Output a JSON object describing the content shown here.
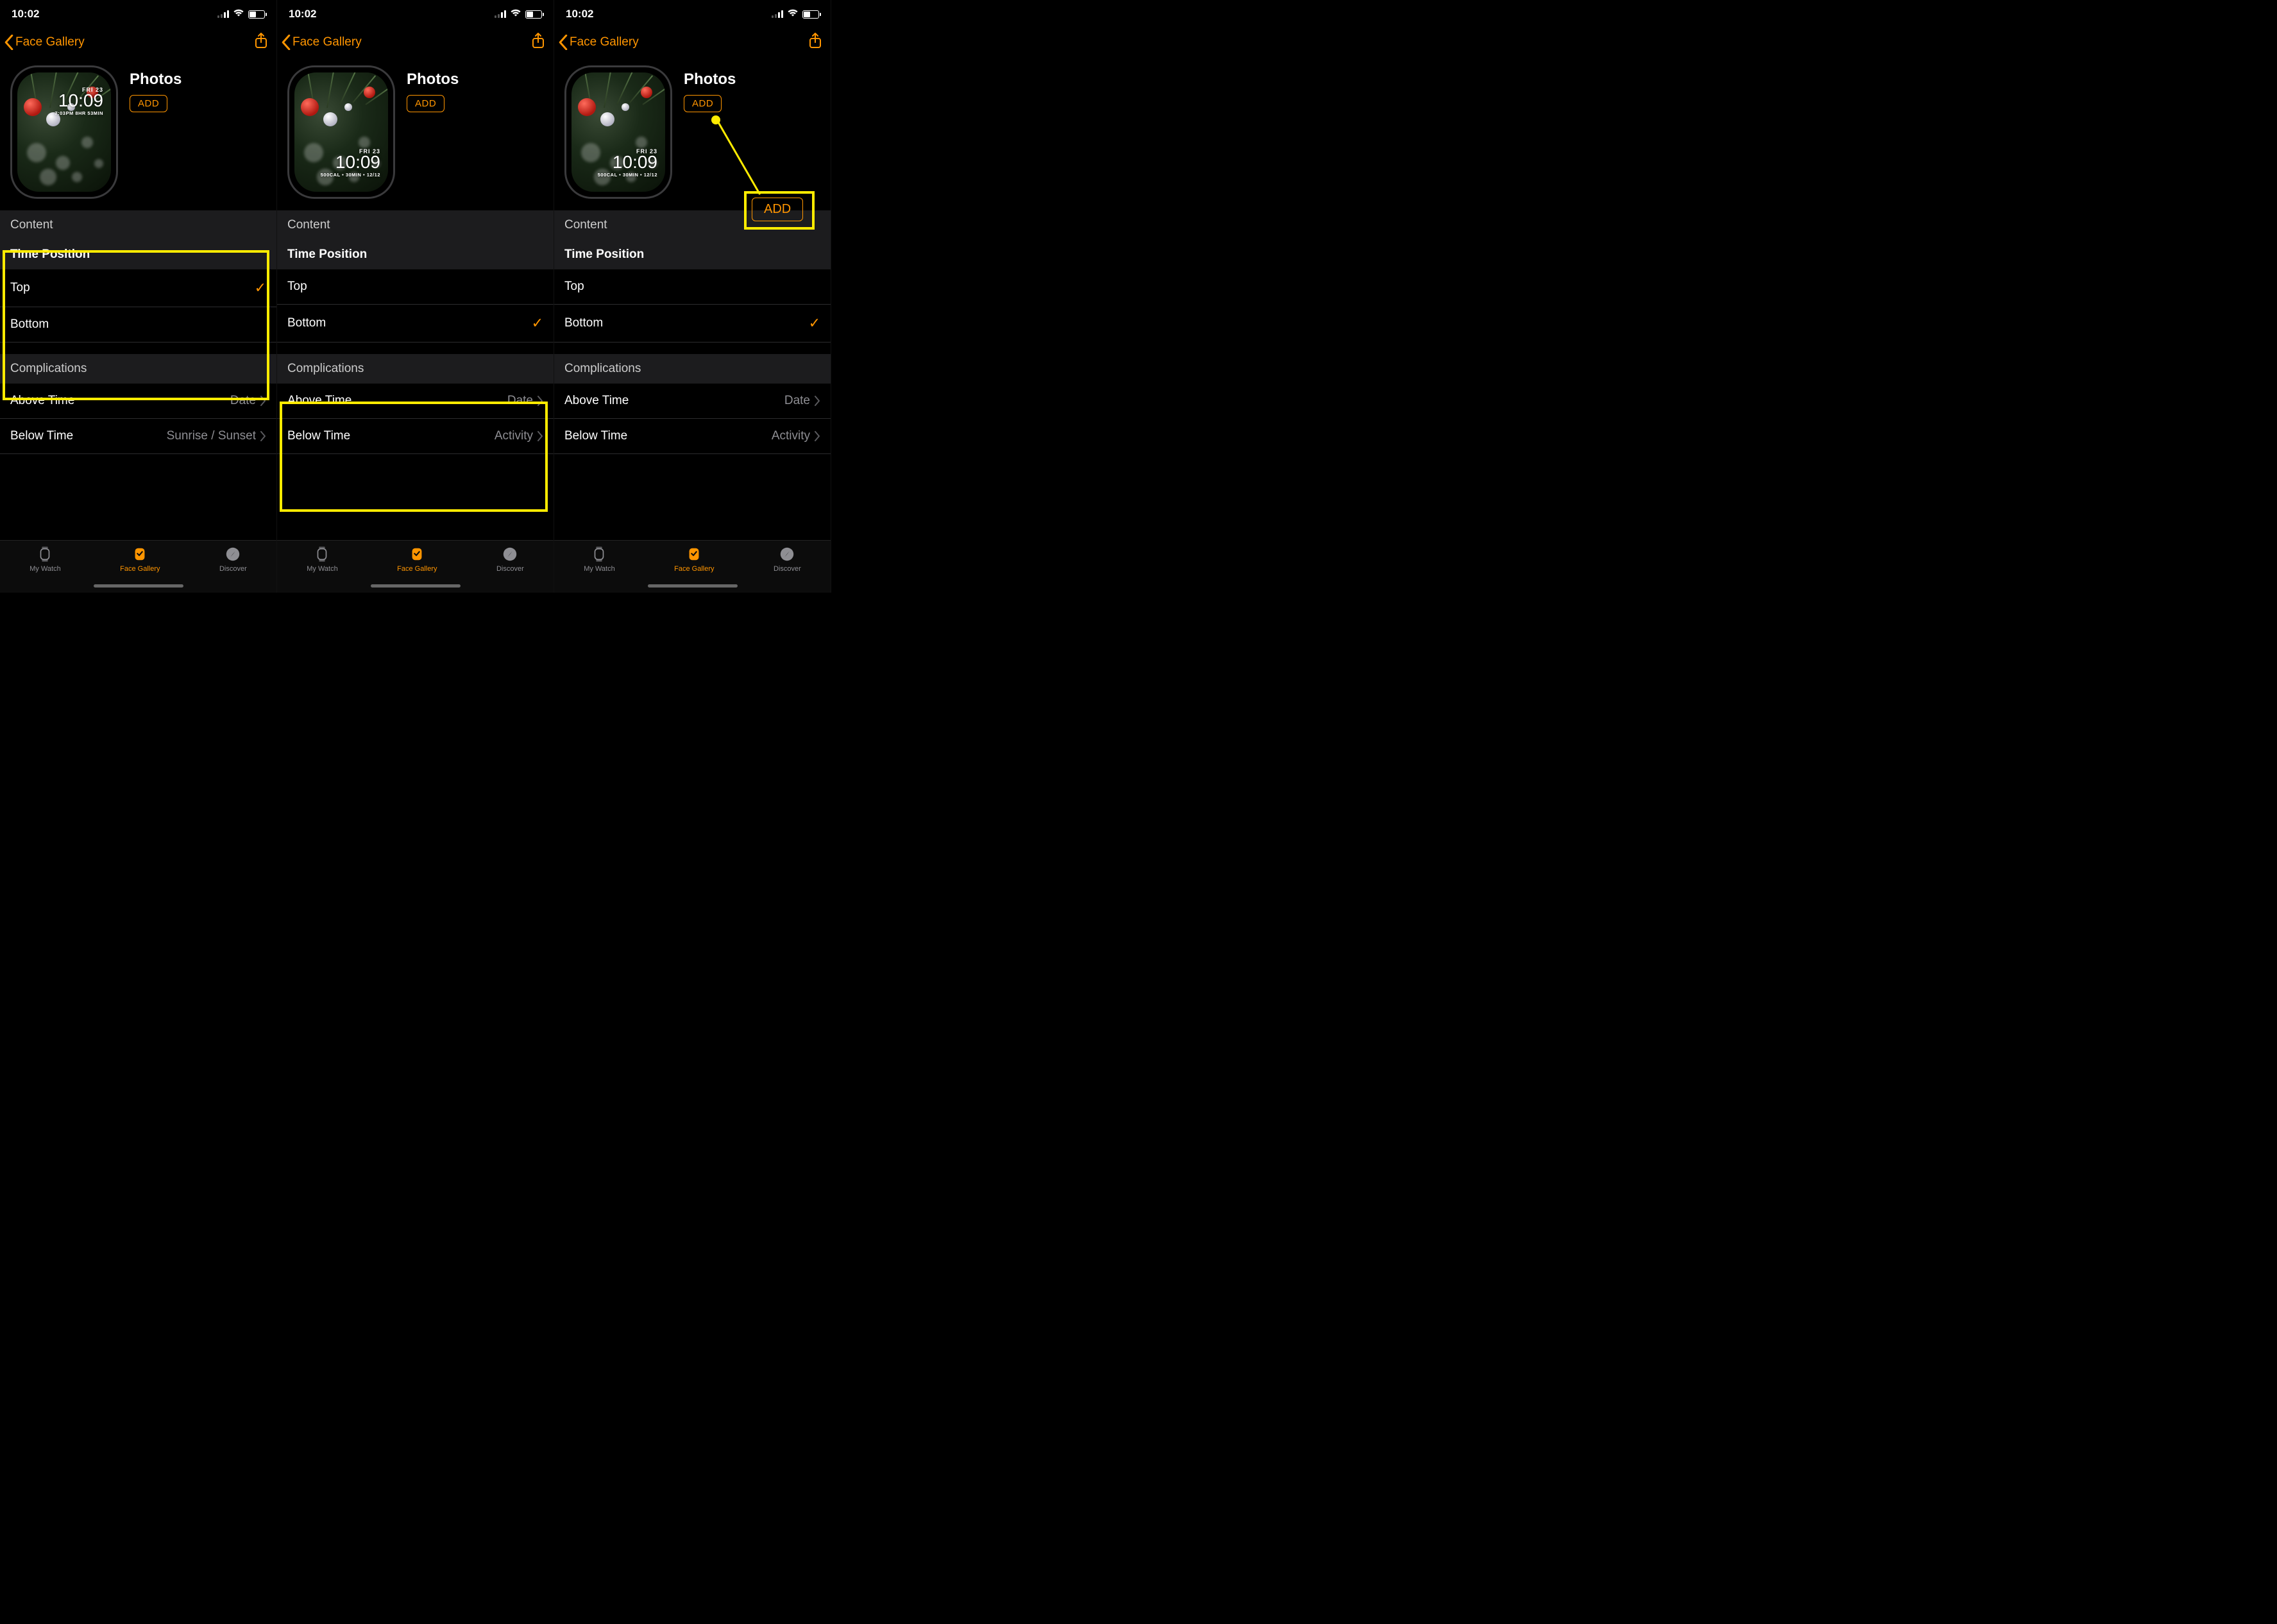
{
  "status": {
    "time": "10:02"
  },
  "nav": {
    "back": "Face Gallery"
  },
  "face": {
    "title": "Photos",
    "add": "ADD",
    "watch_date": "FRI 23",
    "watch_time": "10:09",
    "sub_top": "7:03PM 8HR 53MIN",
    "sub_bottom": "500CAL • 30MIN • 12/12"
  },
  "headers": {
    "content": "Content",
    "time_position": "Time Position",
    "complications": "Complications"
  },
  "rows": {
    "top": "Top",
    "bottom": "Bottom",
    "above_time": "Above Time",
    "below_time": "Below Time",
    "date": "Date",
    "sunrise": "Sunrise / Sunset",
    "activity": "Activity"
  },
  "tabs": {
    "my_watch": "My Watch",
    "face_gallery": "Face Gallery",
    "discover": "Discover"
  },
  "screens": [
    {
      "time_pos": "top",
      "below_val": "sunrise",
      "hl": "timepos"
    },
    {
      "time_pos": "bottom",
      "below_val": "activity",
      "hl": "complications"
    },
    {
      "time_pos": "bottom",
      "below_val": "activity",
      "hl": "add"
    }
  ]
}
